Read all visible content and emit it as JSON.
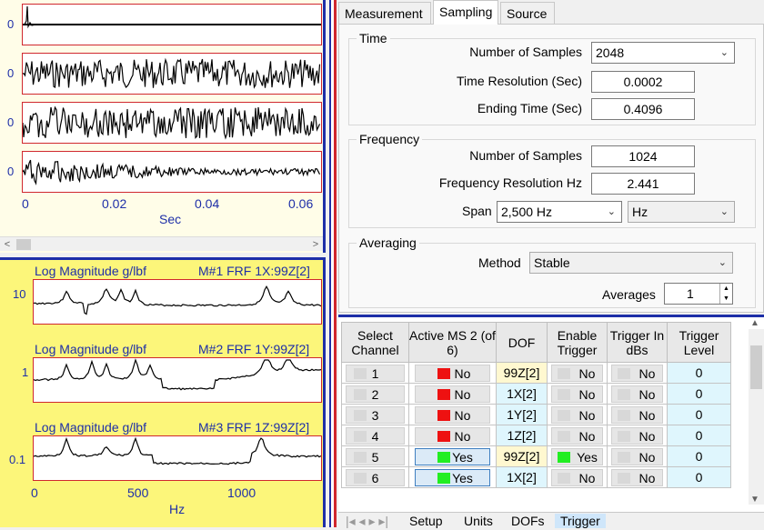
{
  "time_plot": {
    "channel_zero_labels": [
      "0",
      "0",
      "0",
      "0"
    ],
    "x_ticks": [
      "0",
      "0.02",
      "0.04",
      "0.06"
    ],
    "x_axis_title": "Sec"
  },
  "frf_plot": {
    "title_left": "Log Magnitude g/lbf",
    "traces": [
      {
        "title_right": "M#1 FRF 1X:99Z[2]",
        "y_tick": "10"
      },
      {
        "title_right": "M#2 FRF 1Y:99Z[2]",
        "y_tick": "1"
      },
      {
        "title_right": "M#3 FRF 1Z:99Z[2]",
        "y_tick": "0.1"
      }
    ],
    "x_ticks": [
      "0",
      "500",
      "1000"
    ],
    "x_axis_title": "Hz"
  },
  "tabs": [
    {
      "label": "Measurement",
      "active": false
    },
    {
      "label": "Sampling",
      "active": true
    },
    {
      "label": "Source",
      "active": false
    }
  ],
  "sampling": {
    "time_group": "Time",
    "time_num_samples_label": "Number of Samples",
    "time_num_samples_value": "2048",
    "time_resolution_label": "Time Resolution (Sec)",
    "time_resolution_value": "0.0002",
    "ending_time_label": "Ending Time (Sec)",
    "ending_time_value": "0.4096",
    "frequency_group": "Frequency",
    "freq_num_samples_label": "Number of Samples",
    "freq_num_samples_value": "1024",
    "freq_resolution_label": "Frequency Resolution Hz",
    "freq_resolution_value": "2.441",
    "span_label": "Span",
    "span_value": "2,500 Hz",
    "span_unit": "Hz",
    "averaging_group": "Averaging",
    "method_label": "Method",
    "method_value": "Stable",
    "averages_label": "Averages",
    "averages_value": "1"
  },
  "grid": {
    "headers": [
      "Select Channel",
      "Active MS 2 (of 6)",
      "DOF",
      "Enable Trigger",
      "Trigger In dBs",
      "Trigger Level"
    ],
    "rows": [
      {
        "channel": "1",
        "active": "No",
        "dof": "99Z[2]",
        "enable": "No",
        "in_dbs": "No",
        "level": "0"
      },
      {
        "channel": "2",
        "active": "No",
        "dof": "1X[2]",
        "enable": "No",
        "in_dbs": "No",
        "level": "0"
      },
      {
        "channel": "3",
        "active": "No",
        "dof": "1Y[2]",
        "enable": "No",
        "in_dbs": "No",
        "level": "0"
      },
      {
        "channel": "4",
        "active": "No",
        "dof": "1Z[2]",
        "enable": "No",
        "in_dbs": "No",
        "level": "0"
      },
      {
        "channel": "5",
        "active": "Yes",
        "dof": "99Z[2]",
        "enable": "Yes",
        "in_dbs": "No",
        "level": "0"
      },
      {
        "channel": "6",
        "active": "Yes",
        "dof": "1X[2]",
        "enable": "No",
        "in_dbs": "No",
        "level": "0"
      }
    ],
    "sheet_tabs": [
      "Setup",
      "Units",
      "DOFs",
      "Trigger"
    ],
    "active_sheet": "Trigger"
  },
  "colors": {
    "axis_text": "#1e2fa8",
    "frame_red": "#d0282e",
    "frf_background": "#fcf67a",
    "time_background": "#fffde8"
  }
}
